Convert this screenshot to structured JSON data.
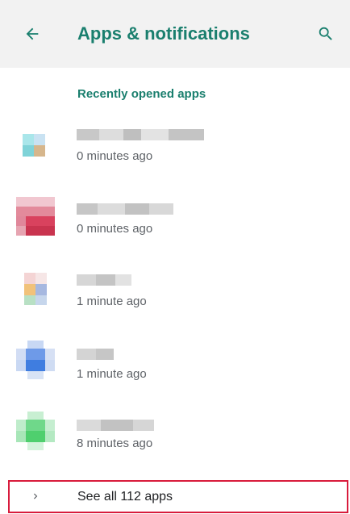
{
  "header": {
    "title": "Apps & notifications",
    "back_icon": "arrow-back-icon",
    "search_icon": "search-icon"
  },
  "recent": {
    "section_title": "Recently opened apps",
    "apps": [
      {
        "name": "",
        "time": "0 minutes ago",
        "icon_color": "#7fd3d8"
      },
      {
        "name": "",
        "time": "0 minutes ago",
        "icon_color": "#d9425e"
      },
      {
        "name": "",
        "time": "1 minute ago",
        "icon_color": "#a6b8e0"
      },
      {
        "name": "",
        "time": "1 minute ago",
        "icon_color": "#3f7de0"
      },
      {
        "name": "",
        "time": "8 minutes ago",
        "icon_color": "#4fcf6e"
      }
    ]
  },
  "see_all": {
    "label": "See all 112 apps",
    "icon": "chevron-right-icon"
  },
  "colors": {
    "accent": "#1a7f6e",
    "highlight_border": "#d81b3c"
  }
}
